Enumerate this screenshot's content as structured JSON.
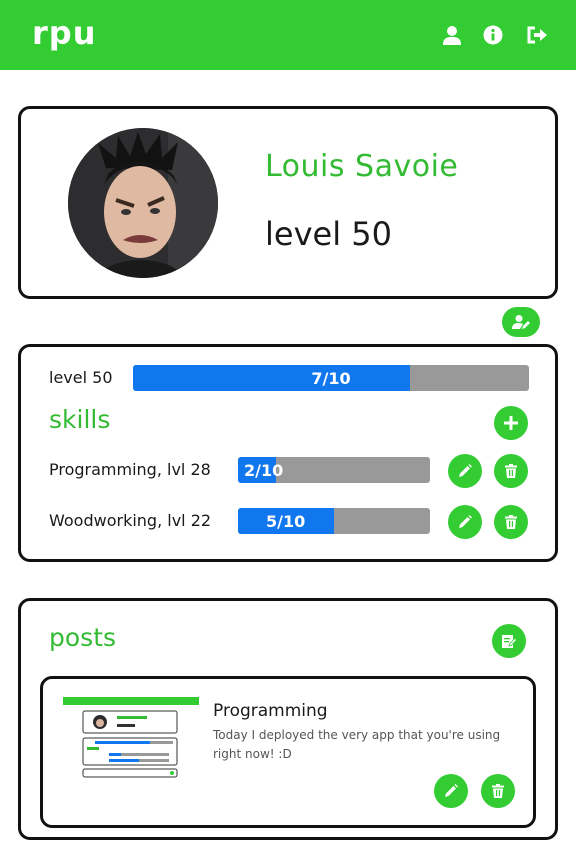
{
  "navbar": {
    "brand": "rpu",
    "icons": [
      "user-icon",
      "info-icon",
      "logout-icon"
    ]
  },
  "profile": {
    "name": "Louis Savoie",
    "level_label": "level 50"
  },
  "xp": {
    "label": "level 50",
    "progress_text": "7/10",
    "progress": 0.7
  },
  "skills": {
    "title": "skills",
    "items": [
      {
        "label": "Programming, lvl 28",
        "progress_text": "2/10",
        "progress": 0.2
      },
      {
        "label": "Woodworking, lvl 22",
        "progress_text": "5/10",
        "progress": 0.5
      }
    ]
  },
  "posts": {
    "title": "posts",
    "items": [
      {
        "title": "Programming",
        "body": "Today I deployed the very app that you're using right now! :D"
      }
    ]
  },
  "colors": {
    "brand_green": "#33cc33",
    "progress_blue": "#1177ee",
    "progress_track": "#999999"
  }
}
